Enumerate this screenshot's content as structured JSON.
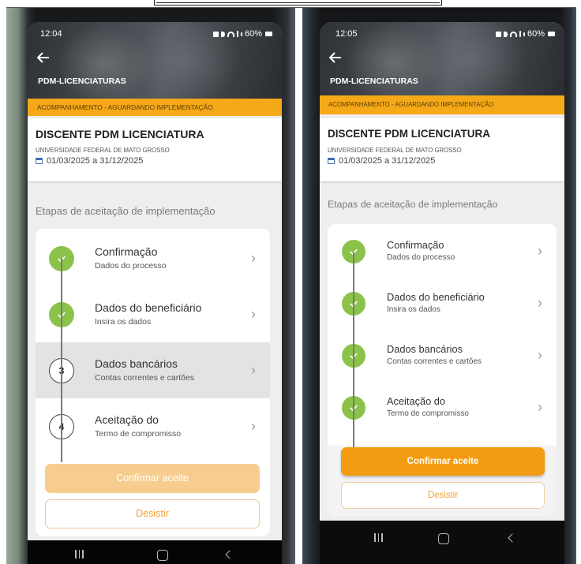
{
  "screens": [
    {
      "time": "12:04",
      "battery": "60%",
      "app_title": "PDM-LICENCIATURAS",
      "status_banner": "ACOMPANHAMENTO - AGUARDANDO IMPLEMENTAÇÃO",
      "card": {
        "title": "DISCENTE PDM LICENCIATURA",
        "institution": "UNIVERSIDADE FEDERAL DE MATO GROSSO",
        "period": "01/03/2025 a 31/12/2025",
        "period_icon": "calendar-icon"
      },
      "section_title": "Etapas de aceitação de implementação",
      "steps": [
        {
          "state": "done",
          "icon": "check-icon",
          "title": "Confirmação",
          "subtitle": "Dados do processo"
        },
        {
          "state": "done",
          "icon": "check-icon",
          "title": "Dados do beneficiário",
          "subtitle": "Insira os dados"
        },
        {
          "state": "pending",
          "number": "3",
          "title": "Dados bancários",
          "subtitle": "Contas correntes e cartões",
          "highlighted": true
        },
        {
          "state": "pending",
          "number": "4",
          "title": "Aceitação do",
          "subtitle": "Termo de compromisso"
        }
      ],
      "confirm_button": {
        "label": "Confirmar aceite",
        "enabled": false
      },
      "cancel_button": {
        "label": "Desistir"
      },
      "nav_icons": [
        "recent-apps-icon",
        "home-icon",
        "back-icon"
      ]
    },
    {
      "time": "12:05",
      "battery": "60%",
      "app_title": "PDM-LICENCIATURAS",
      "status_banner": "ACOMPANHAMENTO - AGUARDANDO IMPLEMENTAÇÃO",
      "card": {
        "title": "DISCENTE PDM LICENCIATURA",
        "institution": "UNIVERSIDADE FEDERAL DE MATO GROSSO",
        "period": "01/03/2025 a 31/12/2025",
        "period_icon": "calendar-icon"
      },
      "section_title": "Etapas de aceitação de implementação",
      "steps": [
        {
          "state": "done",
          "icon": "check-icon",
          "title": "Confirmação",
          "subtitle": "Dados do processo"
        },
        {
          "state": "done",
          "icon": "check-icon",
          "title": "Dados do beneficiário",
          "subtitle": "Insira os dados"
        },
        {
          "state": "done",
          "icon": "check-icon",
          "title": "Dados bancários",
          "subtitle": "Contas correntes e cartões"
        },
        {
          "state": "done",
          "icon": "check-icon",
          "title": "Aceitação do",
          "subtitle": "Termo de compromisso"
        }
      ],
      "confirm_button": {
        "label": "Confirmar aceite",
        "enabled": true
      },
      "cancel_button": {
        "label": "Desistir"
      },
      "nav_icons": [
        "recent-apps-icon",
        "home-icon",
        "back-icon"
      ]
    }
  ],
  "colors": {
    "banner": "#f5a918",
    "step_done": "#8bc34a",
    "confirm_disabled": "#f6cd8f",
    "confirm_enabled": "#f39c12",
    "cancel_text": "#f2a33a"
  }
}
